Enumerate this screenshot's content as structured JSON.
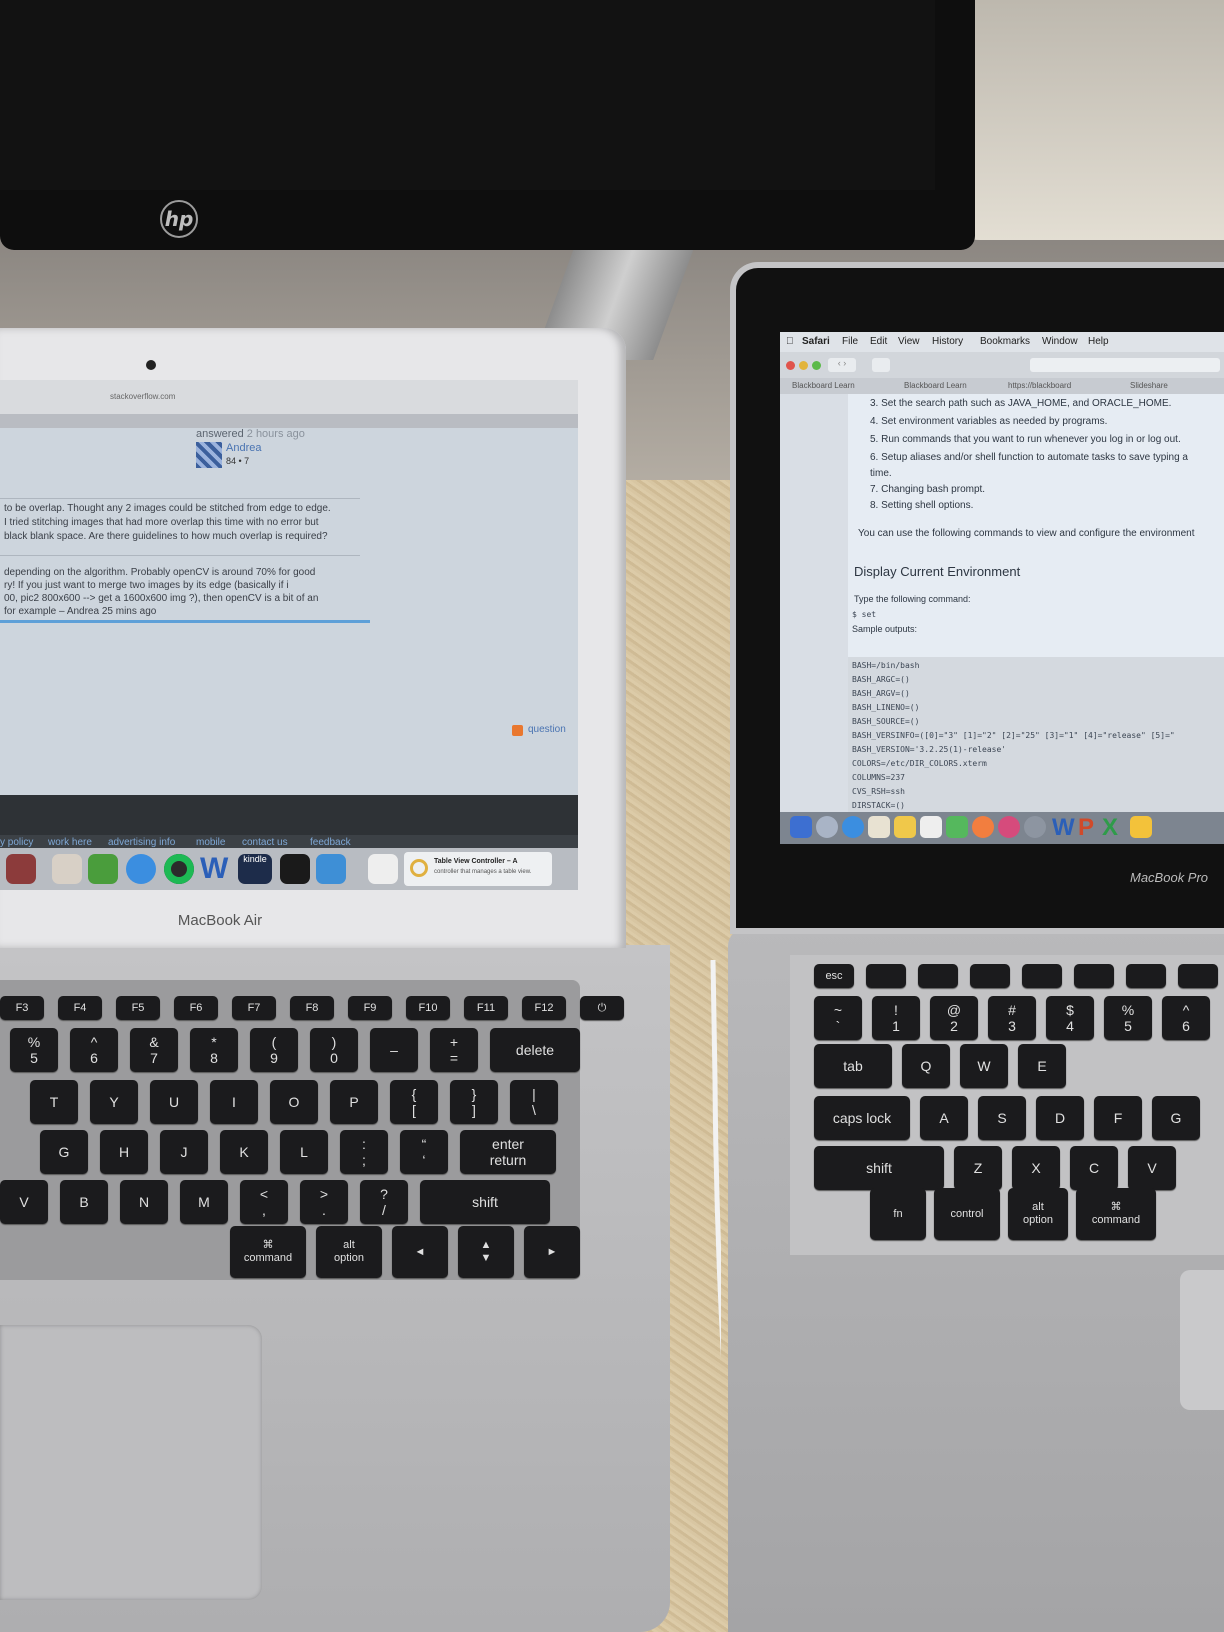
{
  "monitor": {
    "brand_logo": "hp"
  },
  "left_laptop": {
    "brand": "MacBook Air",
    "browser": {
      "url": "stackoverflow.com",
      "answer_meta": {
        "answered": "answered",
        "time": "2 hours ago",
        "user": "Andrea",
        "rep": "84 • 7"
      },
      "question_lines": [
        "to be overlap. Thought any 2 images could be stitched from edge to edge.",
        "I tried stitching images that had more overlap this time with no error but",
        "black blank space. Are there guidelines to how much overlap is required?"
      ],
      "comment_lines": [
        "depending on the algorithm. Probably openCV is around 70% for good",
        "ry! If you just want to merge two images by its edge (basically if i",
        "00, pic2 800x600 --> get a 1600x600 img ?), then openCV is a bit of an",
        "for example – Andrea 25 mins ago"
      ],
      "rss_link": "question",
      "footer_links": [
        "y policy",
        "work here",
        "advertising info",
        "mobile",
        "contact us",
        "feedback"
      ]
    },
    "dock": {
      "icons": [
        "photo-booth-icon",
        "calendar-icon",
        "evernote-icon",
        "safari-icon",
        "spotify-icon",
        "word-icon",
        "kindle-icon",
        "terminal-icon",
        "xcode-icon",
        "notes-icon"
      ],
      "word_label": "W",
      "kindle_label": "kindle"
    },
    "notification": {
      "title": "Table View Controller – A",
      "body": "controller that manages a table view."
    },
    "keyboard": {
      "row_fn": [
        "F3",
        "F4",
        "F5",
        "F6",
        "F7",
        "F8",
        "F9",
        "F10",
        "F11",
        "F12",
        "⏻"
      ],
      "row_num": [
        "%\n5",
        "^\n6",
        "&\n7",
        "*\n8",
        "(\n9",
        ")\n0",
        "–",
        "+\n=",
        "delete"
      ],
      "row_top": [
        "T",
        "Y",
        "U",
        "I",
        "O",
        "P",
        "{\n[",
        "}\n]",
        "|\n\\"
      ],
      "row_home": [
        "G",
        "H",
        "J",
        "K",
        "L",
        ":\n;",
        "“\n‘",
        "enter\nreturn"
      ],
      "row_bottom": [
        "V",
        "B",
        "N",
        "M",
        "<\n,",
        ">\n.",
        "?\n/",
        "shift"
      ],
      "row_space": [
        "⌘\ncommand",
        "alt\noption",
        "◄",
        "▲\n▼",
        "►"
      ]
    }
  },
  "right_laptop": {
    "brand": "MacBook Pro",
    "menubar": [
      "Safari",
      "File",
      "Edit",
      "View",
      "History",
      "Bookmarks",
      "Window",
      "Help"
    ],
    "tabs": [
      "Blackboard Learn",
      "Blackboard Learn",
      "https://blackboard",
      "Slideshare"
    ],
    "list_items": [
      "3.  Set the search path such as JAVA_HOME, and ORACLE_HOME.",
      "4.  Set environment variables as needed by programs.",
      "5.  Run commands that you want to run whenever you log in or log out.",
      "6.  Setup aliases and/or shell function to automate tasks to save typing a",
      "     time.",
      "7.  Changing bash prompt.",
      "8.  Setting shell options."
    ],
    "intro": "You can use the following commands to view and configure the environment",
    "heading": "Display Current Environment",
    "type_cmd": "Type the following command:",
    "cmd": "$ set",
    "sample": "Sample outputs:",
    "code_lines": [
      "BASH=/bin/bash",
      "BASH_ARGC=()",
      "BASH_ARGV=()",
      "BASH_LINENO=()",
      "BASH_SOURCE=()",
      "BASH_VERSINFO=([0]=\"3\" [1]=\"2\" [2]=\"25\" [3]=\"1\" [4]=\"release\" [5]=\"",
      "BASH_VERSION='3.2.25(1)-release'",
      "COLORS=/etc/DIR_COLORS.xterm",
      "COLUMNS=237",
      "CVS_RSH=ssh",
      "DIRSTACK=()"
    ],
    "keyboard": {
      "row_fn": [
        "esc",
        "",
        "",
        "",
        "",
        "",
        "",
        ""
      ],
      "row_num": [
        "~\n`",
        "!\n1",
        "@\n2",
        "#\n3",
        "$\n4",
        "%\n5",
        "^\n6"
      ],
      "row_q": [
        "tab",
        "Q",
        "W",
        "E"
      ],
      "row_a": [
        "caps lock",
        "A",
        "S",
        "D",
        "F",
        "G"
      ],
      "row_z": [
        "shift",
        "Z",
        "X",
        "C",
        "V"
      ],
      "row_space": [
        "fn",
        "control",
        "alt\noption",
        "⌘\ncommand"
      ]
    },
    "dock_letters": [
      "W",
      "P",
      "X"
    ]
  }
}
